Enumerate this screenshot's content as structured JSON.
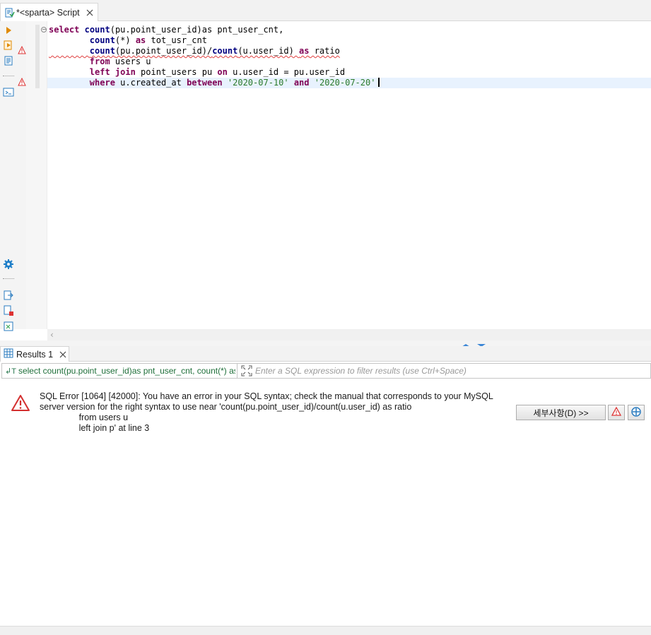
{
  "editor": {
    "tab_label": "*<sparta> Script",
    "code_lines": [
      "select count(pu.point_user_id)as pnt_user_cnt,",
      "        count(*) as tot_usr_cnt",
      "        count(pu.point_user_id)/count(u.user_id) as ratio",
      "        from users u",
      "        left join point_users pu on u.user_id = pu.user_id",
      "        where u.created_at between '2020-07-10' and '2020-07-20'"
    ]
  },
  "results": {
    "tab_label": "Results 1",
    "query_echo": "select count(pu.point_user_id)as pnt_user_cnt, count(*) as",
    "filter_placeholder": "Enter a SQL expression to filter results (use Ctrl+Space)",
    "error_message": "SQL Error [1064] [42000]: You have an error in your SQL syntax; check the manual that corresponds to your MySQL\nserver version for the right syntax to use near 'count(pu.point_user_id)/count(u.user_id) as ratio\n                from users u\n                left join p' at line 3",
    "details_button": "세부사항(D) >>"
  },
  "colors": {
    "keyword": "#7f0055",
    "function": "#000080",
    "string": "#2a7a2a",
    "error": "#e04040",
    "current_line": "#e8f2fe"
  },
  "icons": [
    "sql-script-icon",
    "close-icon",
    "execute-icon",
    "execute-script-icon",
    "explain-plan-icon",
    "terminal-icon",
    "settings-icon",
    "export-icon",
    "error-file-icon",
    "excel-icon",
    "results-grid-icon",
    "filter-expand-icon",
    "error-icon",
    "warning-icon",
    "crosshair-icon"
  ]
}
